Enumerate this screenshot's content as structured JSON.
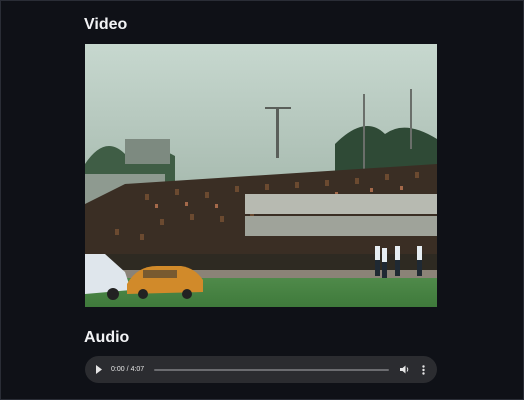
{
  "sections": {
    "video_title": "Video",
    "audio_title": "Audio"
  },
  "audio": {
    "current_time": "0:00",
    "duration": "4:07",
    "progress": 0
  },
  "icons": {
    "play": "play-icon",
    "volume": "volume-icon",
    "more": "more-options-icon"
  },
  "colors": {
    "background": "#0f1117",
    "player_bg": "#2b2c30",
    "text": "#f2f3f5"
  }
}
